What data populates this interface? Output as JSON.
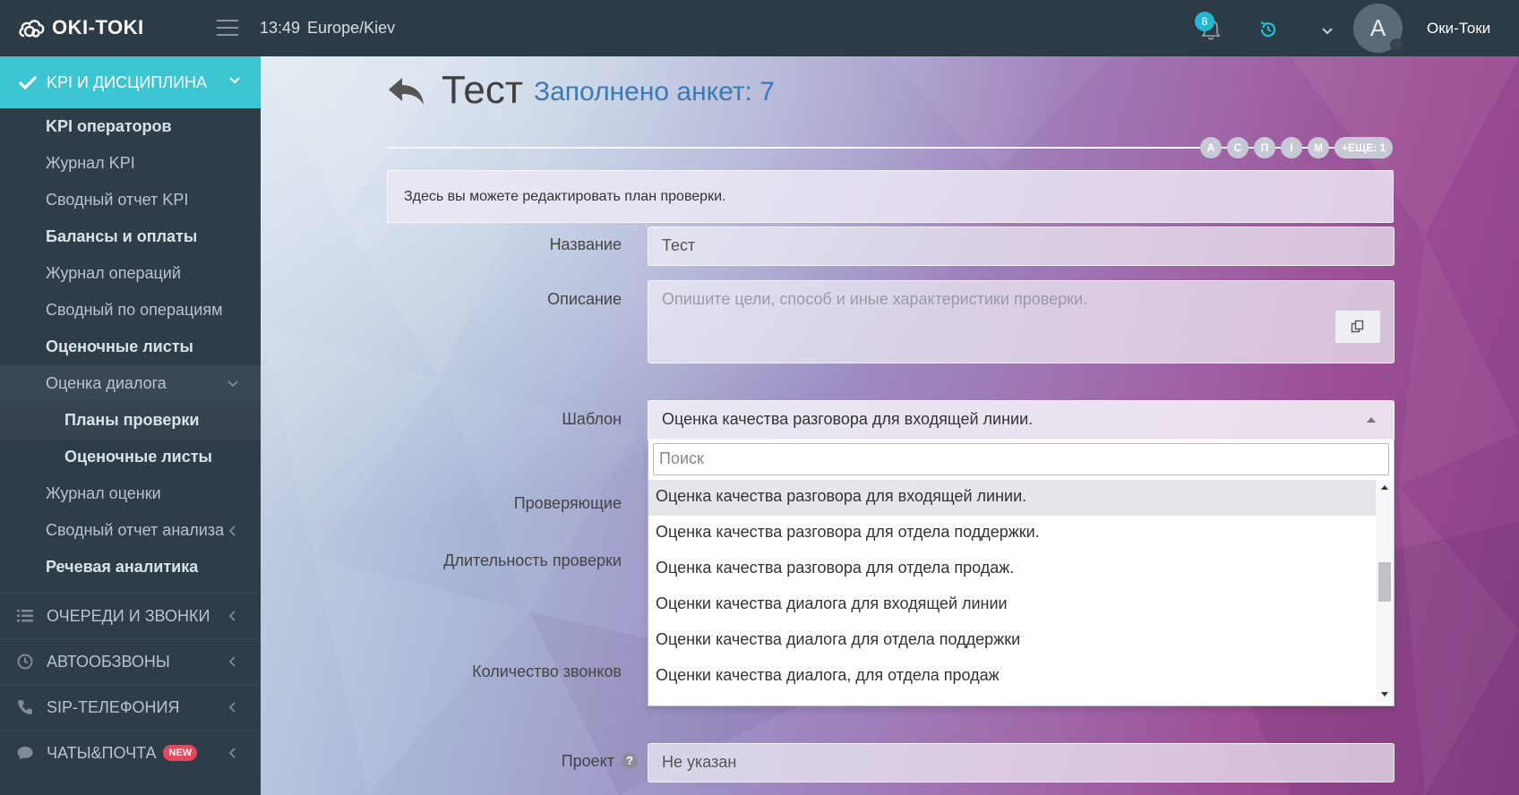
{
  "app": {
    "logo_text": "OKI-TOKI"
  },
  "topbar": {
    "time": "13:49",
    "timezone": "Europe/Kiev",
    "notifications_count": "8",
    "avatar_letter": "A",
    "username": "Оки-Токи",
    "accent_color": "#22b8cf"
  },
  "sidebar": {
    "active_section": "KPI И ДИСЦИПЛИНА",
    "items": [
      {
        "label": "KPI операторов",
        "bold": true
      },
      {
        "label": "Журнал KPI"
      },
      {
        "label": "Сводный отчет KPI"
      },
      {
        "label": "Балансы и оплаты",
        "bold": true
      },
      {
        "label": "Журнал операций"
      },
      {
        "label": "Сводный по операциям"
      },
      {
        "label": "Оценочные листы",
        "bold": true
      },
      {
        "label": "Оценка диалога"
      },
      {
        "label": "Планы проверки",
        "bold": true
      },
      {
        "label": "Оценочные листы",
        "bold": true
      },
      {
        "label": "Журнал оценки"
      },
      {
        "label": "Сводный отчет анализа"
      },
      {
        "label": "Речевая аналитика",
        "bold": true
      }
    ],
    "groups": [
      {
        "label": "ОЧЕРЕДИ И ЗВОНКИ",
        "icon": "list-icon"
      },
      {
        "label": "АВТООБЗВОНЫ",
        "icon": "clock-icon"
      },
      {
        "label": "SIP-ТЕЛЕФОНИЯ",
        "icon": "phone-icon"
      },
      {
        "label": "ЧАТЫ&ПОЧТА",
        "icon": "chat-icon",
        "badge": "NEW"
      }
    ]
  },
  "page": {
    "title": "Тест",
    "filled_forms": "Заполнено анкет: 7",
    "chips": [
      "А",
      "С",
      "П",
      "І",
      "М",
      "+ЕЩЕ: 1"
    ],
    "info_text": "Здесь вы можете редактировать план проверки."
  },
  "form": {
    "name_label": "Название",
    "name_value": "Тест",
    "description_label": "Описание",
    "description_placeholder": "Опишите цели, способ и иные характеристики проверки.",
    "template_label": "Шаблон",
    "template_value": "Оценка качества разговора для входящей линии.",
    "reviewers_label": "Проверяющие",
    "duration_label": "Длительность проверки",
    "calls_label": "Количество звонков",
    "project_label": "Проект",
    "project_help": "?",
    "project_value": "Не указан"
  },
  "dropdown": {
    "search_placeholder": "Поиск",
    "options": [
      "Оценка качества разговора для входящей линии.",
      "Оценка качества разговора для отдела поддержки.",
      "Оценка качества разговора для отдела продаж.",
      "Оценки качества диалога для входящей линии",
      "Оценки качества диалога для отдела поддержки",
      "Оценки качества диалога, для отдела продаж"
    ],
    "selected_index": 0
  }
}
